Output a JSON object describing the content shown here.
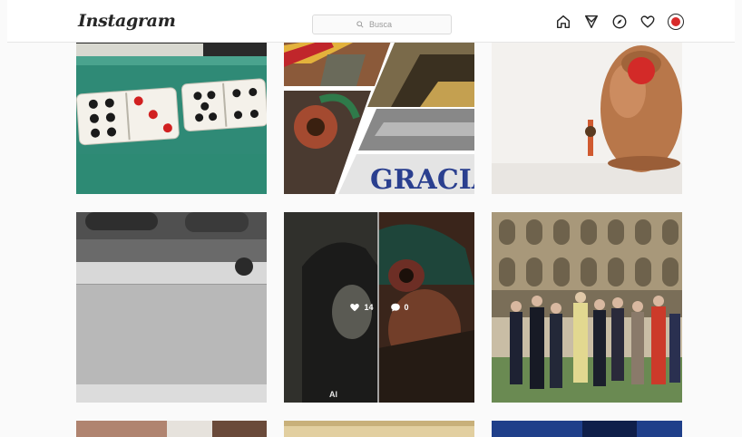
{
  "header": {
    "logo": "Instagram",
    "search_placeholder": "Busca",
    "icons": [
      "home-icon",
      "direct-icon",
      "explore-icon",
      "heart-icon",
      "avatar"
    ]
  },
  "posts": [
    {
      "name": "post-dominoes",
      "description_icon": "dominoes"
    },
    {
      "name": "post-collage-gracias",
      "text": "GRACIA"
    },
    {
      "name": "post-vase"
    },
    {
      "name": "post-grayscale-ledge"
    },
    {
      "name": "post-split-portrait",
      "likes": "14",
      "comments": "0",
      "caption": "Al"
    },
    {
      "name": "post-royal-courtyard"
    },
    {
      "name": "post-row3-left"
    },
    {
      "name": "post-row3-middle"
    },
    {
      "name": "post-row3-right"
    }
  ],
  "colors": {
    "header_bg": "#ffffff",
    "page_bg": "#fafafa",
    "accent_red": "#d82b2b"
  }
}
